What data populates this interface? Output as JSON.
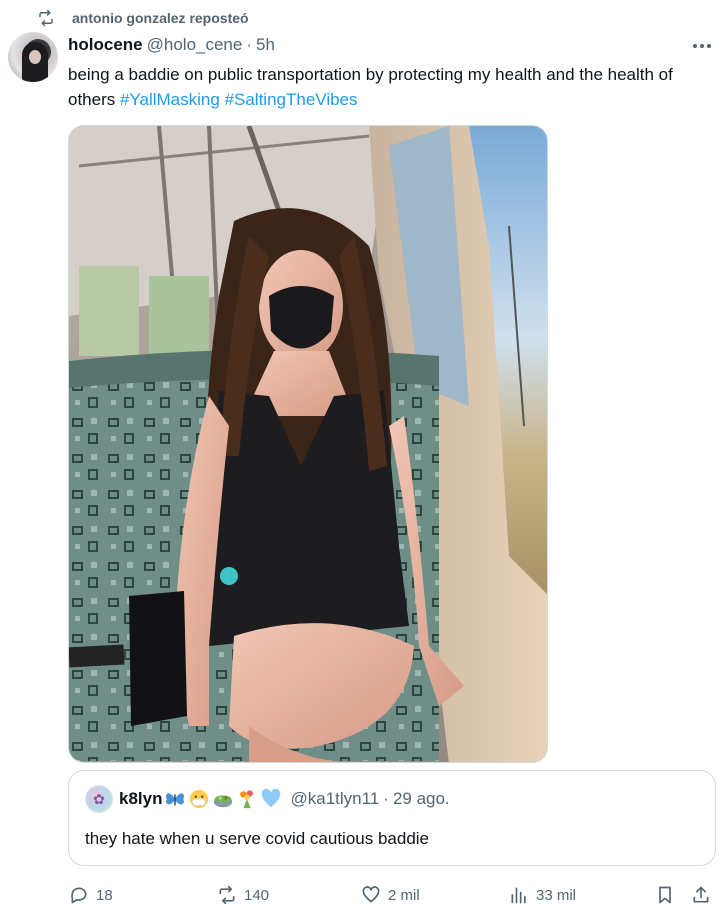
{
  "repost": {
    "text": "antonio gonzalez reposteó",
    "icon": "repost-icon"
  },
  "tweet": {
    "author_name": "holocene",
    "handle": "@holo_cene",
    "separator": "·",
    "time": "5h",
    "text_main": "being a baddie on public transportation by protecting my health and the health of others ",
    "hashtags": [
      "#YallMasking",
      "#SaltingTheVibes"
    ]
  },
  "media": {
    "alt": "Photo of a person wearing a black mask and black dress sitting on a train seat"
  },
  "quote": {
    "author_name": "k8lyn",
    "emojis": [
      "butterfly",
      "mask-face",
      "salad",
      "bouquet",
      "blue-heart"
    ],
    "handle": "@ka1tlyn11",
    "separator": "·",
    "date": "29 ago.",
    "text": "they hate when u serve covid cautious baddie"
  },
  "actions": {
    "replies": "18",
    "reposts": "140",
    "likes": "2 mil",
    "views": "33 mil"
  },
  "colors": {
    "text": "#0f1419",
    "muted": "#536471",
    "link": "#1d9bf0",
    "border": "#cfd9de"
  }
}
